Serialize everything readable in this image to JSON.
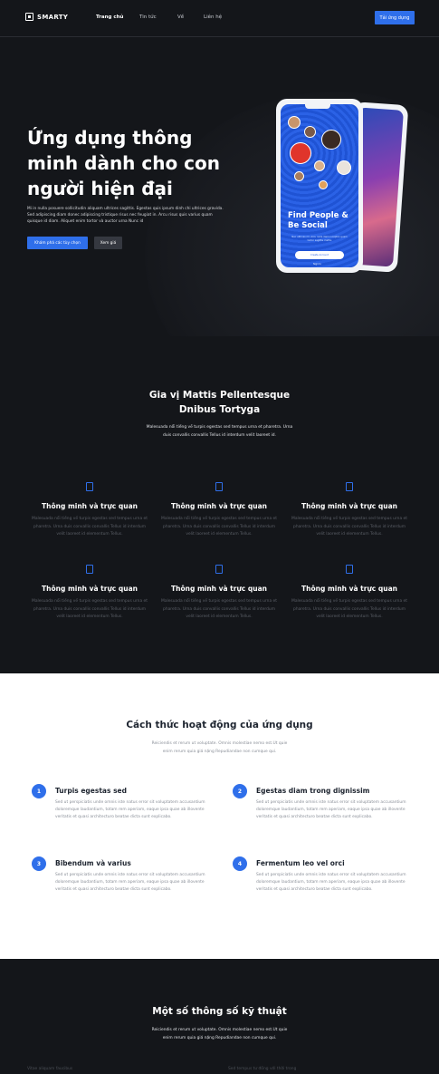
{
  "header": {
    "logo": "SMARTY",
    "nav": [
      "Trang chủ",
      "Tin tức",
      "Về",
      "Liên hệ"
    ],
    "cta": "Tải ứng dụng"
  },
  "hero": {
    "title": "Ứng dụng thông minh dành cho con người hiện đại",
    "desc": "Mi in nulla posuere sollicitudin aliquam ultrices sagittis. Egestas quis ipsum dinh chi ultrices gravida. Sed adipiscing diam donec adipiscing tristique risus nec feugiat in. Arcu risus quis varius quam quisque id diam. Aliquet enim tortor và auctor urna Nunc id",
    "btn_primary": "Khám phá các tùy chọn",
    "btn_secondary": "Xem giá",
    "phone": {
      "headline": "Find People & Be Social",
      "sub": "Nec ultrices mi. Arcu nulla diam inceptos quam tortor sagittis mattis",
      "button": "Create Account",
      "link": "Sign In"
    }
  },
  "features": {
    "title": "Gia vị Mattis Pellentesque Dnibus Tortyga",
    "desc": "Malesuada nổi tiếng về turpis egestas sed tempus urna et pharetra. Urna duis convallis convallis Tellus id interdum velit laoreet id.",
    "items": [
      {
        "title": "Thông minh và trực quan",
        "desc": "Malesuada nổi tiếng về turpis egestas sed tempus urna et pharetra. Urna duis convallis convallis Tellus id interdum velit laoreet id elementum Tellus."
      },
      {
        "title": "Thông minh và trực quan",
        "desc": "Malesuada nổi tiếng về turpis egestas sed tempus urna et pharetra. Urna duis convallis convallis Tellus id interdum velit laoreet id elementum Tellus."
      },
      {
        "title": "Thông minh và trực quan",
        "desc": "Malesuada nổi tiếng về turpis egestas sed tempus urna et pharetra. Urna duis convallis convallis Tellus id interdum velit laoreet id elementum Tellus."
      },
      {
        "title": "Thông minh và trực quan",
        "desc": "Malesuada nổi tiếng về turpis egestas sed tempus urna et pharetra. Urna duis convallis convallis Tellus id interdum velit laoreet id elementum Tellus."
      },
      {
        "title": "Thông minh và trực quan",
        "desc": "Malesuada nổi tiếng về turpis egestas sed tempus urna et pharetra. Urna duis convallis convallis Tellus id interdum velit laoreet id elementum Tellus."
      },
      {
        "title": "Thông minh và trực quan",
        "desc": "Malesuada nổi tiếng về turpis egestas sed tempus urna et pharetra. Urna duis convallis convallis Tellus id interdum velit laoreet id elementum Tellus."
      }
    ]
  },
  "how": {
    "title": "Cách thức hoạt động của ứng dụng",
    "desc": "Reiciendis et rerum ut voluptate. Omnis molestiae nemo est.Ut quie enim rerum quia giá nặng Repudiandae non cumque qui.",
    "steps": [
      {
        "num": "1",
        "title": "Turpis egestas sed",
        "desc": "Sed ut perspiciatis unde omnis iste natus error sit voluptatem accusantium doloremque laudantium, totam rem aperiam, eaque ipsa quae ab illovente veritatis et quasi architecturo beatae dicta sunt explicabo."
      },
      {
        "num": "2",
        "title": "Egestas diam trong dignissim",
        "desc": "Sed ut perspiciatis unde omnis iste natus error sit voluptatem accusantium doloremque laudantium, totam rem aperiam, eaque ipsa quae ab illovente veritatis et quasi architecturo beatae dicta sunt explicabo."
      },
      {
        "num": "3",
        "title": "Bibendum và varius",
        "desc": "Sed ut perspiciatis unde omnis iste natus error sit voluptatem accusantium doloremque laudantium, totam rem aperiam, eaque ipsa quae ab illovente veritatis et quasi architecturo beatae dicta sunt explicabo."
      },
      {
        "num": "4",
        "title": "Fermentum leo vel orci",
        "desc": "Sed ut perspiciatis unde omnis iste natus error sit voluptatem accusantium doloremque laudantium, totam rem aperiam, eaque ipsa quae ab illovente veritatis et quasi architecturo beatae dicta sunt explicabo."
      }
    ]
  },
  "specs": {
    "title": "Một số thông số kỹ thuật",
    "desc": "Reiciendis et rerum ut voluptate. Omnis molestiae nemo est.Ut quie enim rerum quia giá nặng Repudiandae non cumque qui.",
    "foot_left": "Vitae aliquam faucibus",
    "foot_right": "Sed tempus tư đồng với thời trong"
  },
  "colors": {
    "accent": "#2f6fea",
    "dark_bg": "#14161a",
    "light_bg": "#ffffff"
  }
}
